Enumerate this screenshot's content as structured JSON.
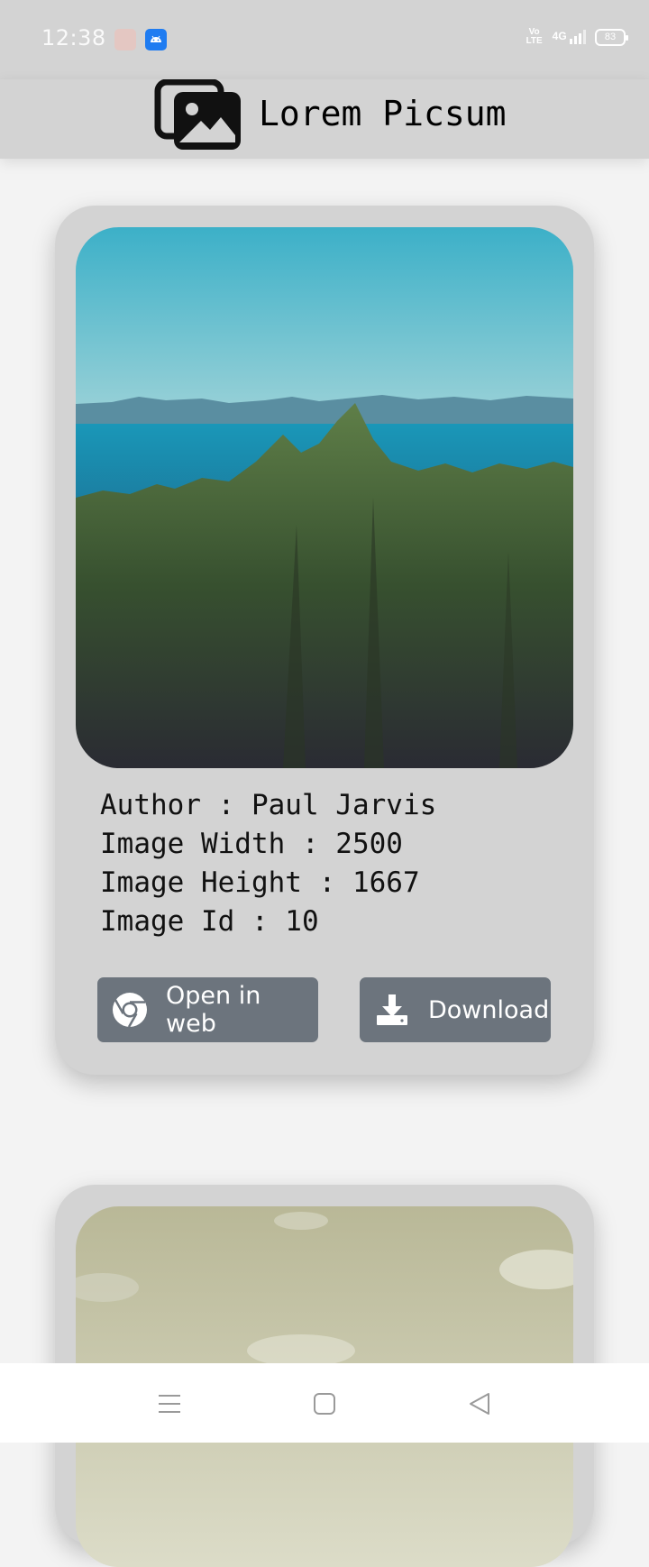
{
  "status_bar": {
    "time": "12:38",
    "network_volte": "Vo LTE",
    "network_type": "4G",
    "battery": "83",
    "notification_icons": [
      "app-notification-icon",
      "android-icon"
    ]
  },
  "app_bar": {
    "title": "Lorem Picsum",
    "logo_icon": "images-icon"
  },
  "cards": [
    {
      "author_line": "Author : Paul Jarvis",
      "width_line": "Image Width : 2500",
      "height_line": "Image Height : 1667",
      "id_line": "Image Id : 10",
      "open_label": "Open in web",
      "download_label": "Download"
    }
  ],
  "nav_bar": {
    "icons": [
      "menu-icon",
      "home-icon",
      "back-icon"
    ]
  },
  "colors": {
    "app_bar": "#d3d3d3",
    "background": "#f3f3f3",
    "card": "#d3d3d3",
    "button": "#6c747d"
  }
}
